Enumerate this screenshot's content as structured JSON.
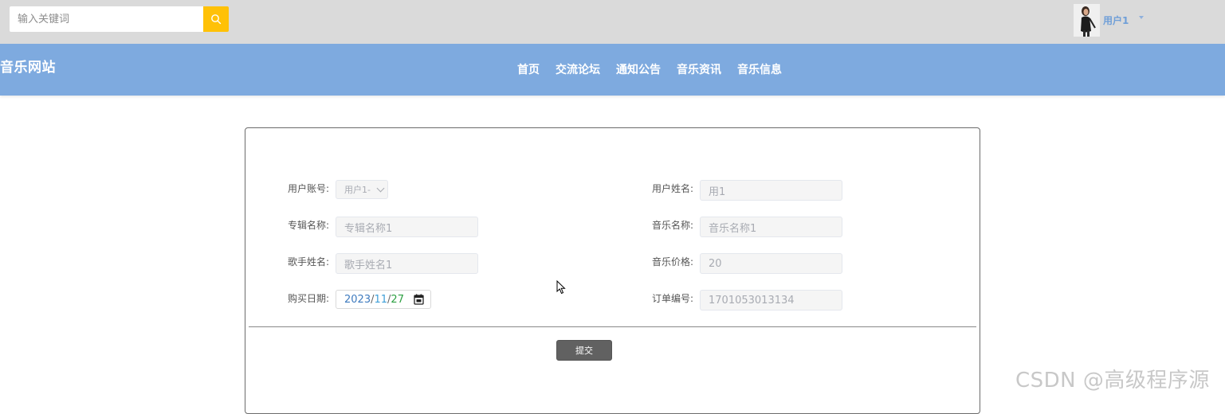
{
  "search": {
    "placeholder": "输入关键词",
    "icon": "search-icon"
  },
  "user": {
    "name": "用户1",
    "avatar": "avatar-photo",
    "caret_icon": "caret-down-icon"
  },
  "header": {
    "site_title": "音乐网站",
    "nav": [
      "首页",
      "交流论坛",
      "通知公告",
      "音乐资讯",
      "音乐信息"
    ]
  },
  "form": {
    "fields": {
      "account": {
        "label": "用户账号:",
        "value": "用户1-"
      },
      "user_name": {
        "label": "用户姓名:",
        "value": "用1"
      },
      "album_name": {
        "label": "专辑名称:",
        "value": "专辑名称1"
      },
      "music_name": {
        "label": "音乐名称:",
        "value": "音乐名称1"
      },
      "singer_name": {
        "label": "歌手姓名:",
        "value": "歌手姓名1"
      },
      "music_price": {
        "label": "音乐价格:",
        "value": "20"
      },
      "purchase_date": {
        "label": "购买日期:",
        "year": "2023",
        "month": "11",
        "day": "27",
        "sep": "/"
      },
      "order_no": {
        "label": "订单编号:",
        "value": "1701053013134"
      }
    },
    "submit_label": "提交"
  },
  "watermark": "CSDN @高级程序源",
  "colors": {
    "topbar_bg": "#dadada",
    "nav_bg": "#7eaadf",
    "search_button": "#ffc107",
    "submit_button": "#616161",
    "user_name": "#6f9fd8"
  }
}
